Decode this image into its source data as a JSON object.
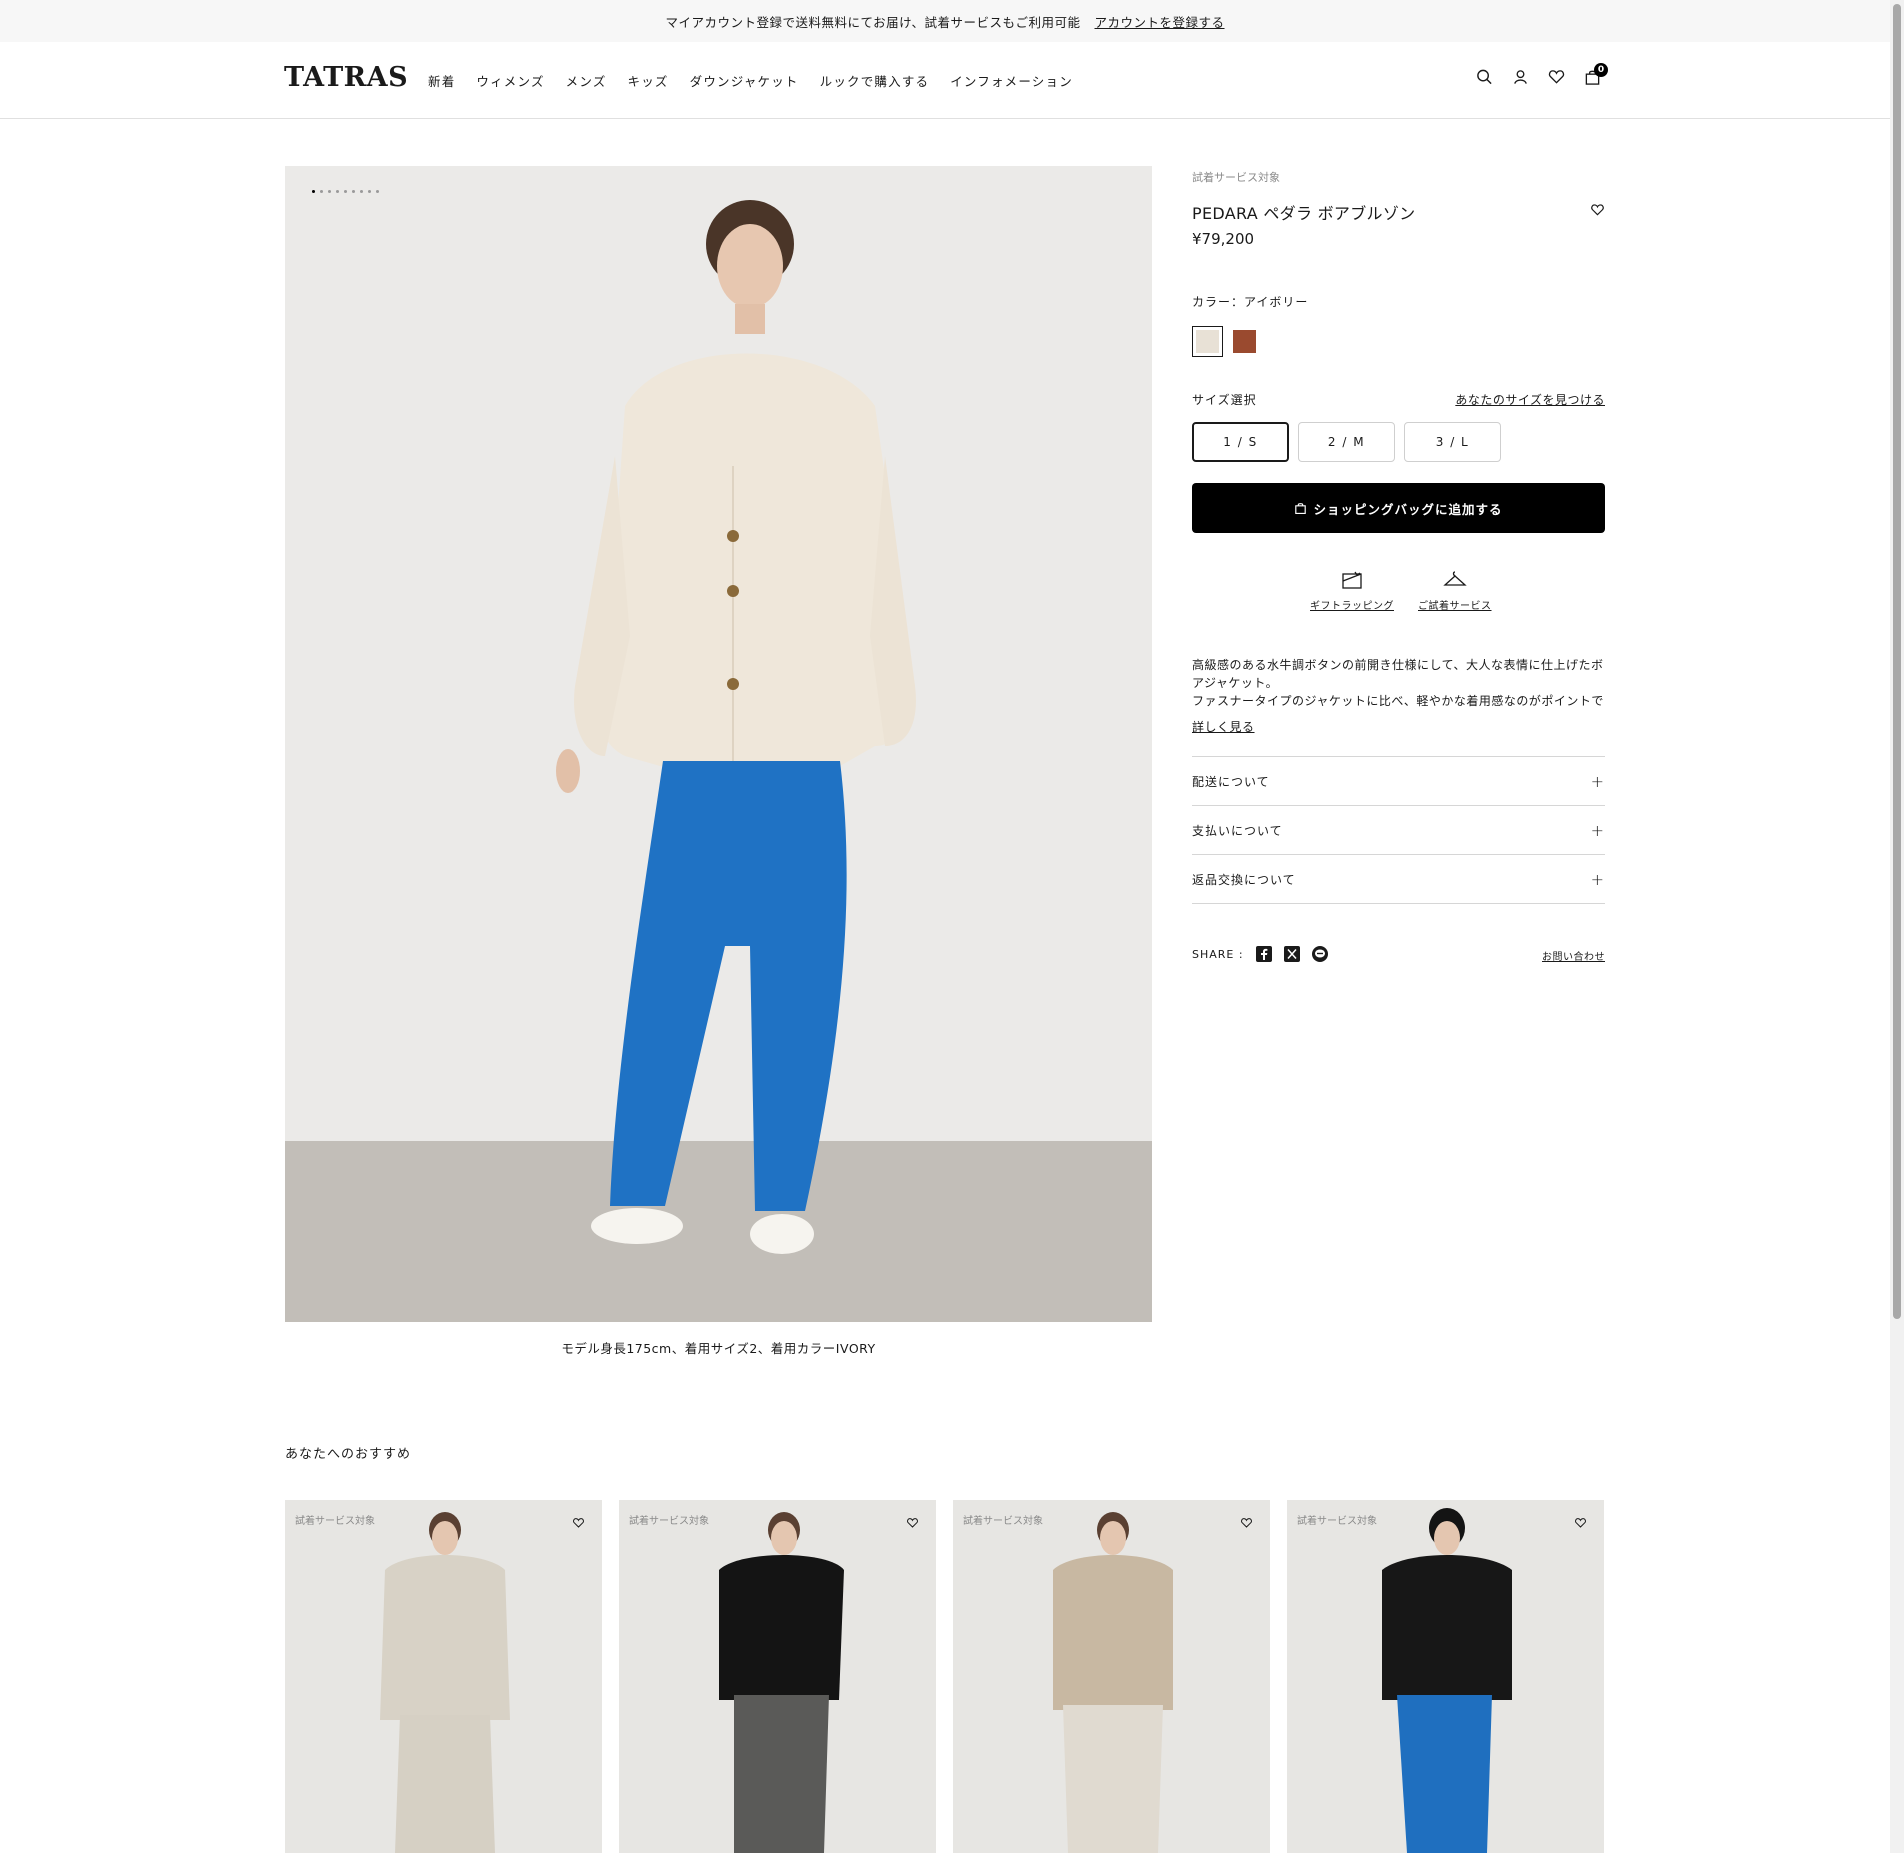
{
  "announcement": {
    "text": "マイアカウント登録で送料無料にてお届け、試着サービスもご利用可能",
    "link": "アカウントを登録する"
  },
  "header": {
    "logo": "TATRAS",
    "nav": [
      "新着",
      "ウィメンズ",
      "メンズ",
      "キッズ",
      "ダウンジャケット",
      "ルックで購入する",
      "インフォメーション"
    ],
    "icons": [
      "search-icon",
      "account-icon",
      "wishlist-icon",
      "bag-icon"
    ],
    "cart_count": "0"
  },
  "gallery": {
    "dot_count": 9,
    "active_dot": 0,
    "caption": "モデル身長175cm、着用サイズ2、着用カラーIVORY"
  },
  "product": {
    "tag": "試着サービス対象",
    "title": "PEDARA ペダラ ボアブルゾン",
    "price": "¥79,200",
    "color_label": "カラー：アイボリー",
    "swatches": [
      {
        "name": "アイボリー",
        "color": "#e8e1d6",
        "selected": true
      },
      {
        "name": "brown",
        "color": "#9a4a2f",
        "selected": false
      }
    ],
    "size_label": "サイズ選択",
    "find_size": "あなたのサイズを見つける",
    "sizes": [
      "1 / S",
      "2 / M",
      "3 / L"
    ],
    "selected_size": "1 / S",
    "add_to_bag": "ショッピングバッグに追加する",
    "services": [
      "ギフトラッピング",
      "ご試着サービス"
    ],
    "description_1": "高級感のある水牛調ボタンの前開き仕様にして、大人な表情に仕上げたボアジャケット。",
    "description_2": "ファスナータイプのジャケットに比べ、軽やかな着用感なのがポイントで",
    "read_more": "詳しく見る",
    "accordions": [
      "配送について",
      "支払いについて",
      "返品交換について"
    ],
    "share_label": "SHARE :",
    "share_icons": [
      "facebook-icon",
      "x-icon",
      "line-icon"
    ],
    "contact": "お問い合わせ"
  },
  "recommendations": {
    "title": "あなたへのおすすめ",
    "items": [
      {
        "tag": "試着サービス対象",
        "jacket": "#d8d2c6",
        "pants": "#d6d0c4"
      },
      {
        "tag": "試着サービス対象",
        "jacket": "#141414",
        "pants": "#5a5a58"
      },
      {
        "tag": "試着サービス対象",
        "jacket": "#c8b8a2",
        "pants": "#e0dad0"
      },
      {
        "tag": "試着サービス対象",
        "jacket": "#171717",
        "pants": "#1f6fbf"
      }
    ]
  },
  "colors": {
    "accent": "#000000",
    "pants_blue": "#1f72c4",
    "jacket_ivory": "#efe7da"
  }
}
